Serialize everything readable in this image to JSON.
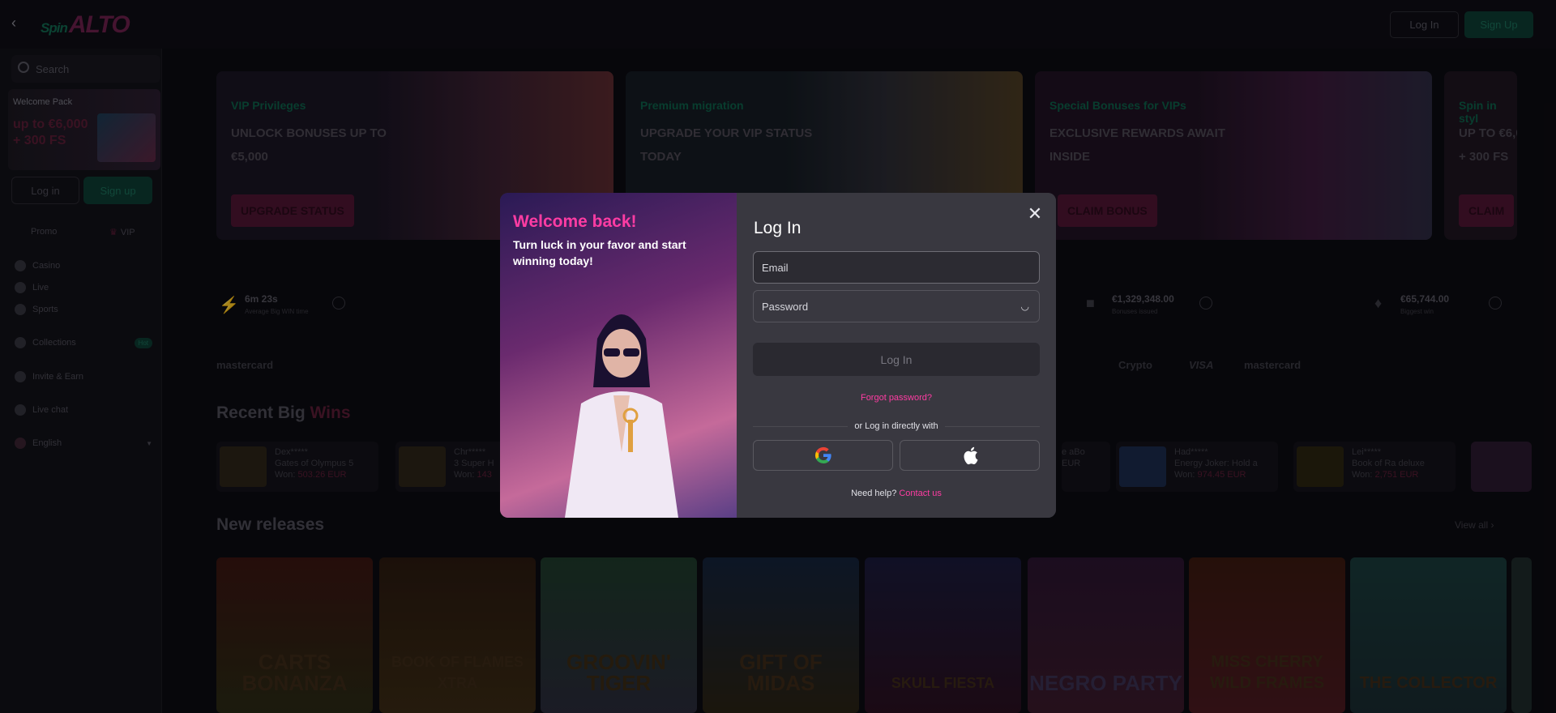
{
  "brand": {
    "logo_prefix": "Spin",
    "logo_main": "ALTO"
  },
  "header": {
    "login_label": "Log In",
    "signup_label": "Sign Up"
  },
  "sidebar": {
    "search_placeholder": "Search",
    "welcome_pack": {
      "title": "Welcome Pack",
      "offer_line1": "up to €6,000",
      "offer_line2": "+ 300 FS"
    },
    "login_label": "Log in",
    "signup_label": "Sign up",
    "tabs": [
      {
        "label": "Promo"
      },
      {
        "label": "VIP"
      }
    ],
    "items": [
      {
        "label": "Casino"
      },
      {
        "label": "Live"
      },
      {
        "label": "Sports"
      },
      {
        "label": "Collections",
        "badge": "Hot"
      },
      {
        "label": "Invite & Earn"
      },
      {
        "label": "Live chat"
      },
      {
        "label": "English"
      }
    ]
  },
  "banners": [
    {
      "kicker": "VIP Privileges",
      "headline": "UNLOCK BONUSES UP TO €5,000",
      "button": "UPGRADE STATUS"
    },
    {
      "kicker": "Premium migration",
      "headline": "UPGRADE YOUR VIP STATUS TODAY",
      "button": ""
    },
    {
      "kicker": "Special Bonuses for VIPs",
      "headline": "EXCLUSIVE REWARDS AWAIT INSIDE",
      "button": "CLAIM BONUS"
    },
    {
      "kicker": "Spin in styl",
      "headline": "UP TO €6,0 + 300 FS",
      "button": "CLAIM"
    }
  ],
  "stats": [
    {
      "value": "6m 23s",
      "label": "Average Big WIN time"
    },
    {
      "value": "€1,329,348.00",
      "label": "Bonuses issued"
    },
    {
      "value": "€65,744.00",
      "label": "Biggest win"
    }
  ],
  "payments": [
    "mastercard",
    "Crypto",
    "VISA",
    "mastercard"
  ],
  "sections": {
    "recent_wins_title_a": "Recent Big",
    "recent_wins_title_b": "Wins",
    "new_releases_title": "New releases",
    "view_all": "View all"
  },
  "recent_wins": [
    {
      "user": "Dex*****",
      "game": "Gates of Olympus 5",
      "won": "Won:",
      "amount": "503.26 EUR"
    },
    {
      "user": "Chr*****",
      "game": "3 Super H",
      "won": "Won:",
      "amount": "143"
    },
    {
      "user": "",
      "game": "e aBo",
      "won": "",
      "amount": "EUR"
    },
    {
      "user": "Had*****",
      "game": "Energy Joker: Hold a",
      "won": "Won:",
      "amount": "974.45 EUR"
    },
    {
      "user": "Lei*****",
      "game": "Book of Ra deluxe",
      "won": "Won:",
      "amount": "2,751 EUR"
    }
  ],
  "games": [
    {
      "title": "Carts Bonanza"
    },
    {
      "title": "Book of Flames Xtra"
    },
    {
      "title": "Groovin' Tiger"
    },
    {
      "title": "Gift of Midas"
    },
    {
      "title": "Skull Fiesta"
    },
    {
      "title": ""
    },
    {
      "title": "Negro Party"
    },
    {
      "title": "Miss Cherry Wild Frames"
    },
    {
      "title": "The Collector"
    }
  ],
  "modal": {
    "welcome_title": "Welcome back!",
    "welcome_subtitle": "Turn luck in your favor and start winning today!",
    "title": "Log In",
    "email_placeholder": "Email",
    "password_placeholder": "Password",
    "login_button": "Log In",
    "forgot": "Forgot password?",
    "or_text": "or Log in directly with",
    "help_text": "Need help?",
    "contact": "Contact us"
  },
  "colors": {
    "accent_pink": "#ff3ca3",
    "accent_green": "#0f5a48",
    "modal_bg": "#393840"
  }
}
